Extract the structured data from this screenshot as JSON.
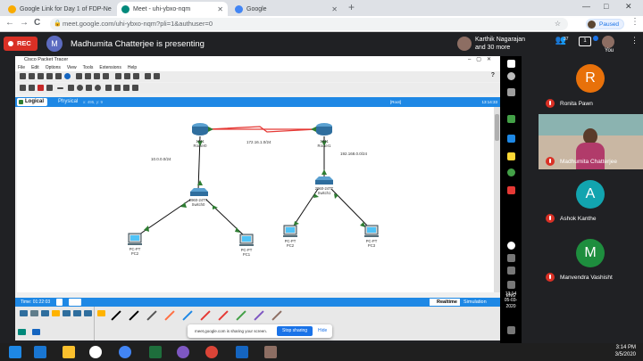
{
  "browser": {
    "tabs": [
      {
        "label": "Google Link for Day 1 of FDP-Ne"
      },
      {
        "label": "Meet - uhi-ybxo-nqm"
      },
      {
        "label": "Google"
      }
    ],
    "new_tab": "+",
    "window_controls": [
      "—",
      "□",
      "✕"
    ],
    "url": "meet.google.com/uhi-ybxo-nqm?pli=1&authuser=0",
    "profile_status": "Paused",
    "nav": {
      "back": "←",
      "forward": "→",
      "reload": "C"
    }
  },
  "meet": {
    "rec_label": "REC",
    "presenter_initial": "M",
    "presenter_text": "Madhumita Chatterjee is presenting",
    "others_line1": "Karthik Nagarajan",
    "others_line2": "and 30 more",
    "people_count": "37",
    "chat_count": "1",
    "you_label": "You",
    "participants": [
      {
        "initial": "R",
        "name": "Ronita Pawn",
        "color": "#e8710a"
      },
      {
        "initial": "",
        "name": "Madhumita Chatterjee",
        "color": "#5a4632"
      },
      {
        "initial": "A",
        "name": "Ashok Kanthe",
        "color": "#12a4af"
      },
      {
        "initial": "M",
        "name": "Manvendra Vashisht",
        "color": "#1e8e3e"
      }
    ],
    "share_notice": "meet.google.com is sharing your screen.",
    "stop_sharing": "Stop sharing",
    "hide": "Hide"
  },
  "packet_tracer": {
    "title": "Cisco Packet Tracer",
    "menu": [
      "File",
      "Edit",
      "Options",
      "View",
      "Tools",
      "Extensions",
      "Help"
    ],
    "help_icon": "?",
    "logical_tab": "Logical",
    "physical_tab": "Physical",
    "coords_text": "x: 495, y: 9",
    "root": "[Root]",
    "clock": "13:14:33",
    "time_label": "Time: 01:22:03",
    "realtime": "Realtime",
    "simulation": "Simulation",
    "devices": {
      "router0": {
        "type": "1941",
        "name": "Router0"
      },
      "router1": {
        "type": "1941",
        "name": "Router1"
      },
      "switch0": {
        "type": "2960-24TT",
        "name": "Switch0"
      },
      "switch1": {
        "type": "2960-24TT",
        "name": "Switch1"
      },
      "pc0": {
        "type": "PC-PT",
        "name": "PC0"
      },
      "pc1": {
        "type": "PC-PT",
        "name": "PC1"
      },
      "pc2": {
        "type": "PC-PT",
        "name": "PC2"
      },
      "pc3": {
        "type": "PC-PT",
        "name": "PC3"
      }
    },
    "networks": {
      "left": "10.0.0.0/24",
      "wan": "172.16.1.0/24",
      "right": "192.168.0.0/24"
    }
  },
  "system": {
    "lang": "ENG",
    "tray_time": "13:14",
    "tray_date": "05-03-2020",
    "taskbar_time": "3:14 PM",
    "taskbar_date": "3/5/2020"
  },
  "colors": {
    "rec": "#d93025",
    "pt_blue": "#1e88e5",
    "wan_link": "#e53935",
    "lan_link": "#111111",
    "port_green": "#2e7d32"
  }
}
